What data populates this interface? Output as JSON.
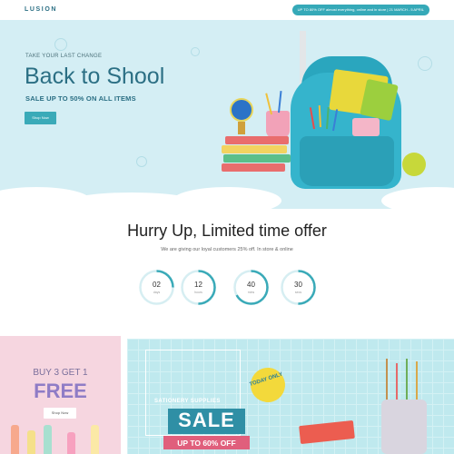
{
  "header": {
    "logo_text": "LUSION",
    "promo_text": "UP TO 80% OFF almost everything, online and in store | 21 MARCH - 5 APRIL"
  },
  "hero": {
    "kicker": "TAKE YOUR LAST CHANGE",
    "title": "Back to Shool",
    "subtitle": "SALE UP TO 50% ON ALL ITEMS",
    "button_label": "Shop Now"
  },
  "offer": {
    "title": "Hurry Up, Limited time offer",
    "subtitle": "We are giving our loyal customers 25% off. In store & online",
    "timers": [
      {
        "value": "02",
        "unit": "days",
        "progress": 0.25
      },
      {
        "value": "12",
        "unit": "hours",
        "progress": 0.5
      },
      {
        "value": "40",
        "unit": "mins",
        "progress": 0.67
      },
      {
        "value": "30",
        "unit": "secs",
        "progress": 0.5
      }
    ]
  },
  "banner_left": {
    "line1": "BUY 3 GET 1",
    "line2": "FREE",
    "button_label": "Shop Now"
  },
  "banner_right": {
    "kicker": "SATIONERY SUPPLIES",
    "sale": "SALE",
    "ribbon": "UP TO 60% OFF",
    "badge": "TODAY ONLY"
  },
  "colors": {
    "accent": "#35a9b8",
    "hero_bg": "#d4eef4",
    "title": "#2b6f84",
    "free": "#8f7cc6",
    "ribbon": "#e05f7c",
    "badge": "#f3d93b"
  }
}
